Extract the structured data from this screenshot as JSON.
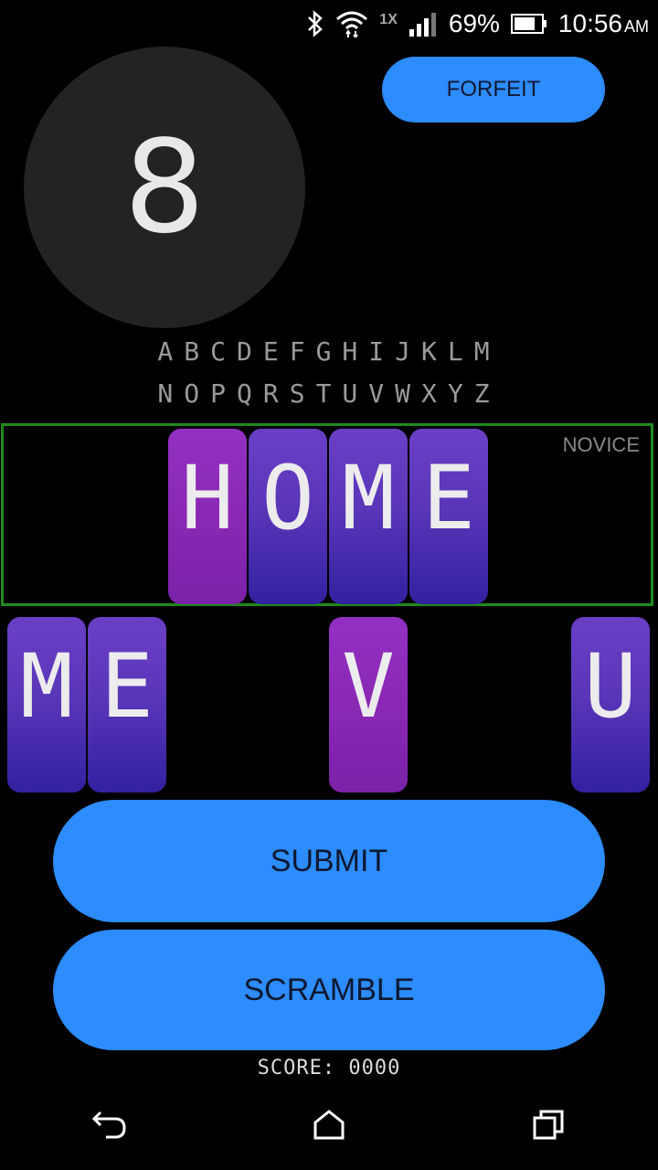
{
  "status_bar": {
    "network_mode": "1X",
    "battery": "69%",
    "time": "10:56",
    "ampm": "AM"
  },
  "timer": {
    "value": "8"
  },
  "forfeit_label": "FORFEIT",
  "alphabet": {
    "row1": "ABCDEFGHIJKLM",
    "row2": "NOPQRSTUVWXYZ"
  },
  "level": "NOVICE",
  "word_tiles": [
    {
      "letter": "H",
      "color": "magenta"
    },
    {
      "letter": "O",
      "color": "blue"
    },
    {
      "letter": "M",
      "color": "blue"
    },
    {
      "letter": "E",
      "color": "blue"
    }
  ],
  "pool_tiles": [
    {
      "letter": "M",
      "color": "blue"
    },
    {
      "letter": "E",
      "color": "blue"
    },
    {
      "letter": "V",
      "color": "magenta"
    },
    {
      "letter": "U",
      "color": "blue"
    }
  ],
  "submit_label": "SUBMIT",
  "scramble_label": "SCRAMBLE",
  "score_text": "SCORE: 0000",
  "colors": {
    "accent": "#2d8cff",
    "tile_blue": "#5a36b8",
    "tile_magenta": "#8a28b4",
    "board_border": "#1e8a1e"
  }
}
